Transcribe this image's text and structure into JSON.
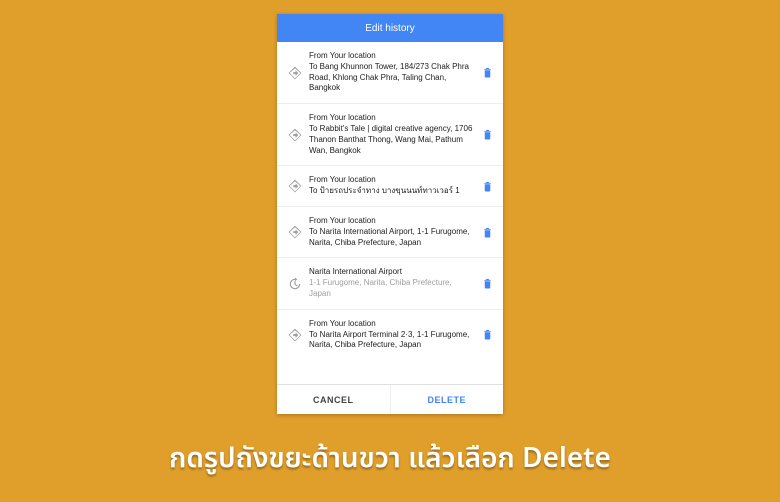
{
  "header": {
    "title": "Edit history"
  },
  "items": [
    {
      "type": "route",
      "icon": "directions",
      "from": "From Your location",
      "to": "To Bang Khunnon Tower, 184/273 Chak Phra Road, Khlong Chak Phra, Taling Chan, Bangkok"
    },
    {
      "type": "route",
      "icon": "directions",
      "from": "From Your location",
      "to": "To Rabbit's Tale | digital creative agency, 1706 Thanon Banthat Thong, Wang Mai, Pathum Wan, Bangkok"
    },
    {
      "type": "route",
      "icon": "directions",
      "from": "From Your location",
      "to": "To ป้ายรถประจำทาง บางขุนนนท์ทาวเวอร์ 1"
    },
    {
      "type": "route",
      "icon": "directions",
      "from": "From Your location",
      "to": "To Narita International Airport, 1-1 Furugome, Narita, Chiba Prefecture, Japan"
    },
    {
      "type": "place",
      "icon": "history",
      "title": "Narita International Airport",
      "sub": "1-1 Furugome, Narita, Chiba Prefecture, Japan"
    },
    {
      "type": "route",
      "icon": "directions",
      "from": "From Your location",
      "to": "To Narita Airport Terminal 2·3, 1-1 Furugome, Narita, Chiba Prefecture, Japan"
    }
  ],
  "footer": {
    "cancel": "CANCEL",
    "delete": "DELETE"
  },
  "caption": "กดรูปถังขยะด้านขวา แล้วเลือก Delete"
}
